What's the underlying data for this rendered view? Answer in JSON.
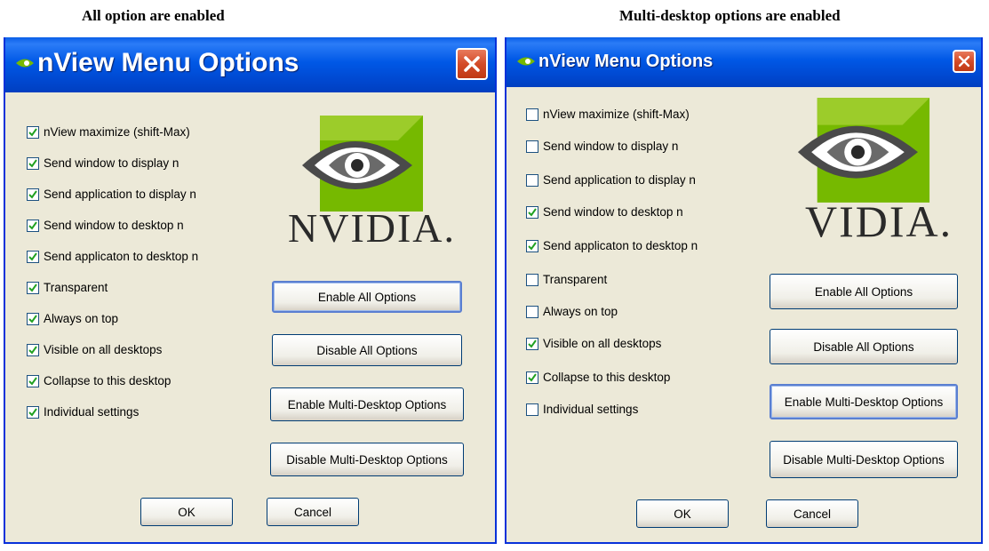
{
  "captions": {
    "left": "All option are enabled",
    "right": "Multi-desktop options are enabled"
  },
  "dialogs": [
    {
      "title": "nView Menu Options",
      "logo_text": "NVIDIA.",
      "options": [
        {
          "label": "nView maximize (shift-Max)",
          "checked": true
        },
        {
          "label": "Send window to display n",
          "checked": true
        },
        {
          "label": "Send application to display n",
          "checked": true
        },
        {
          "label": "Send window to desktop n",
          "checked": true
        },
        {
          "label": "Send applicaton to desktop n",
          "checked": true
        },
        {
          "label": "Transparent",
          "checked": true
        },
        {
          "label": "Always on top",
          "checked": true
        },
        {
          "label": "Visible on all desktops",
          "checked": true
        },
        {
          "label": "Collapse to this desktop",
          "checked": true
        },
        {
          "label": "Individual settings",
          "checked": true
        }
      ],
      "buttons": {
        "enable_all": "Enable All Options",
        "disable_all": "Disable All Options",
        "enable_multi": "Enable Multi-Desktop Options",
        "disable_multi": "Disable Multi-Desktop Options",
        "ok": "OK",
        "cancel": "Cancel"
      }
    },
    {
      "title": "nView Menu Options",
      "logo_text": "VIDIA.",
      "options": [
        {
          "label": "nView maximize (shift-Max)",
          "checked": false
        },
        {
          "label": "Send window to display n",
          "checked": false
        },
        {
          "label": "Send application to display n",
          "checked": false
        },
        {
          "label": "Send window to desktop n",
          "checked": true
        },
        {
          "label": "Send applicaton to desktop n",
          "checked": true
        },
        {
          "label": "Transparent",
          "checked": false
        },
        {
          "label": "Always on top",
          "checked": false
        },
        {
          "label": "Visible on all desktops",
          "checked": true
        },
        {
          "label": "Collapse to this desktop",
          "checked": true
        },
        {
          "label": "Individual settings",
          "checked": false
        }
      ],
      "buttons": {
        "enable_all": "Enable All Options",
        "disable_all": "Disable All Options",
        "enable_multi": "Enable Multi-Desktop Options",
        "disable_multi": "Disable Multi-Desktop Options",
        "ok": "OK",
        "cancel": "Cancel"
      }
    }
  ],
  "colors": {
    "titlebar": "#0058e6",
    "dialog_bg": "#ece9d8",
    "close_button": "#d34b28",
    "logo_green": "#76b900"
  }
}
